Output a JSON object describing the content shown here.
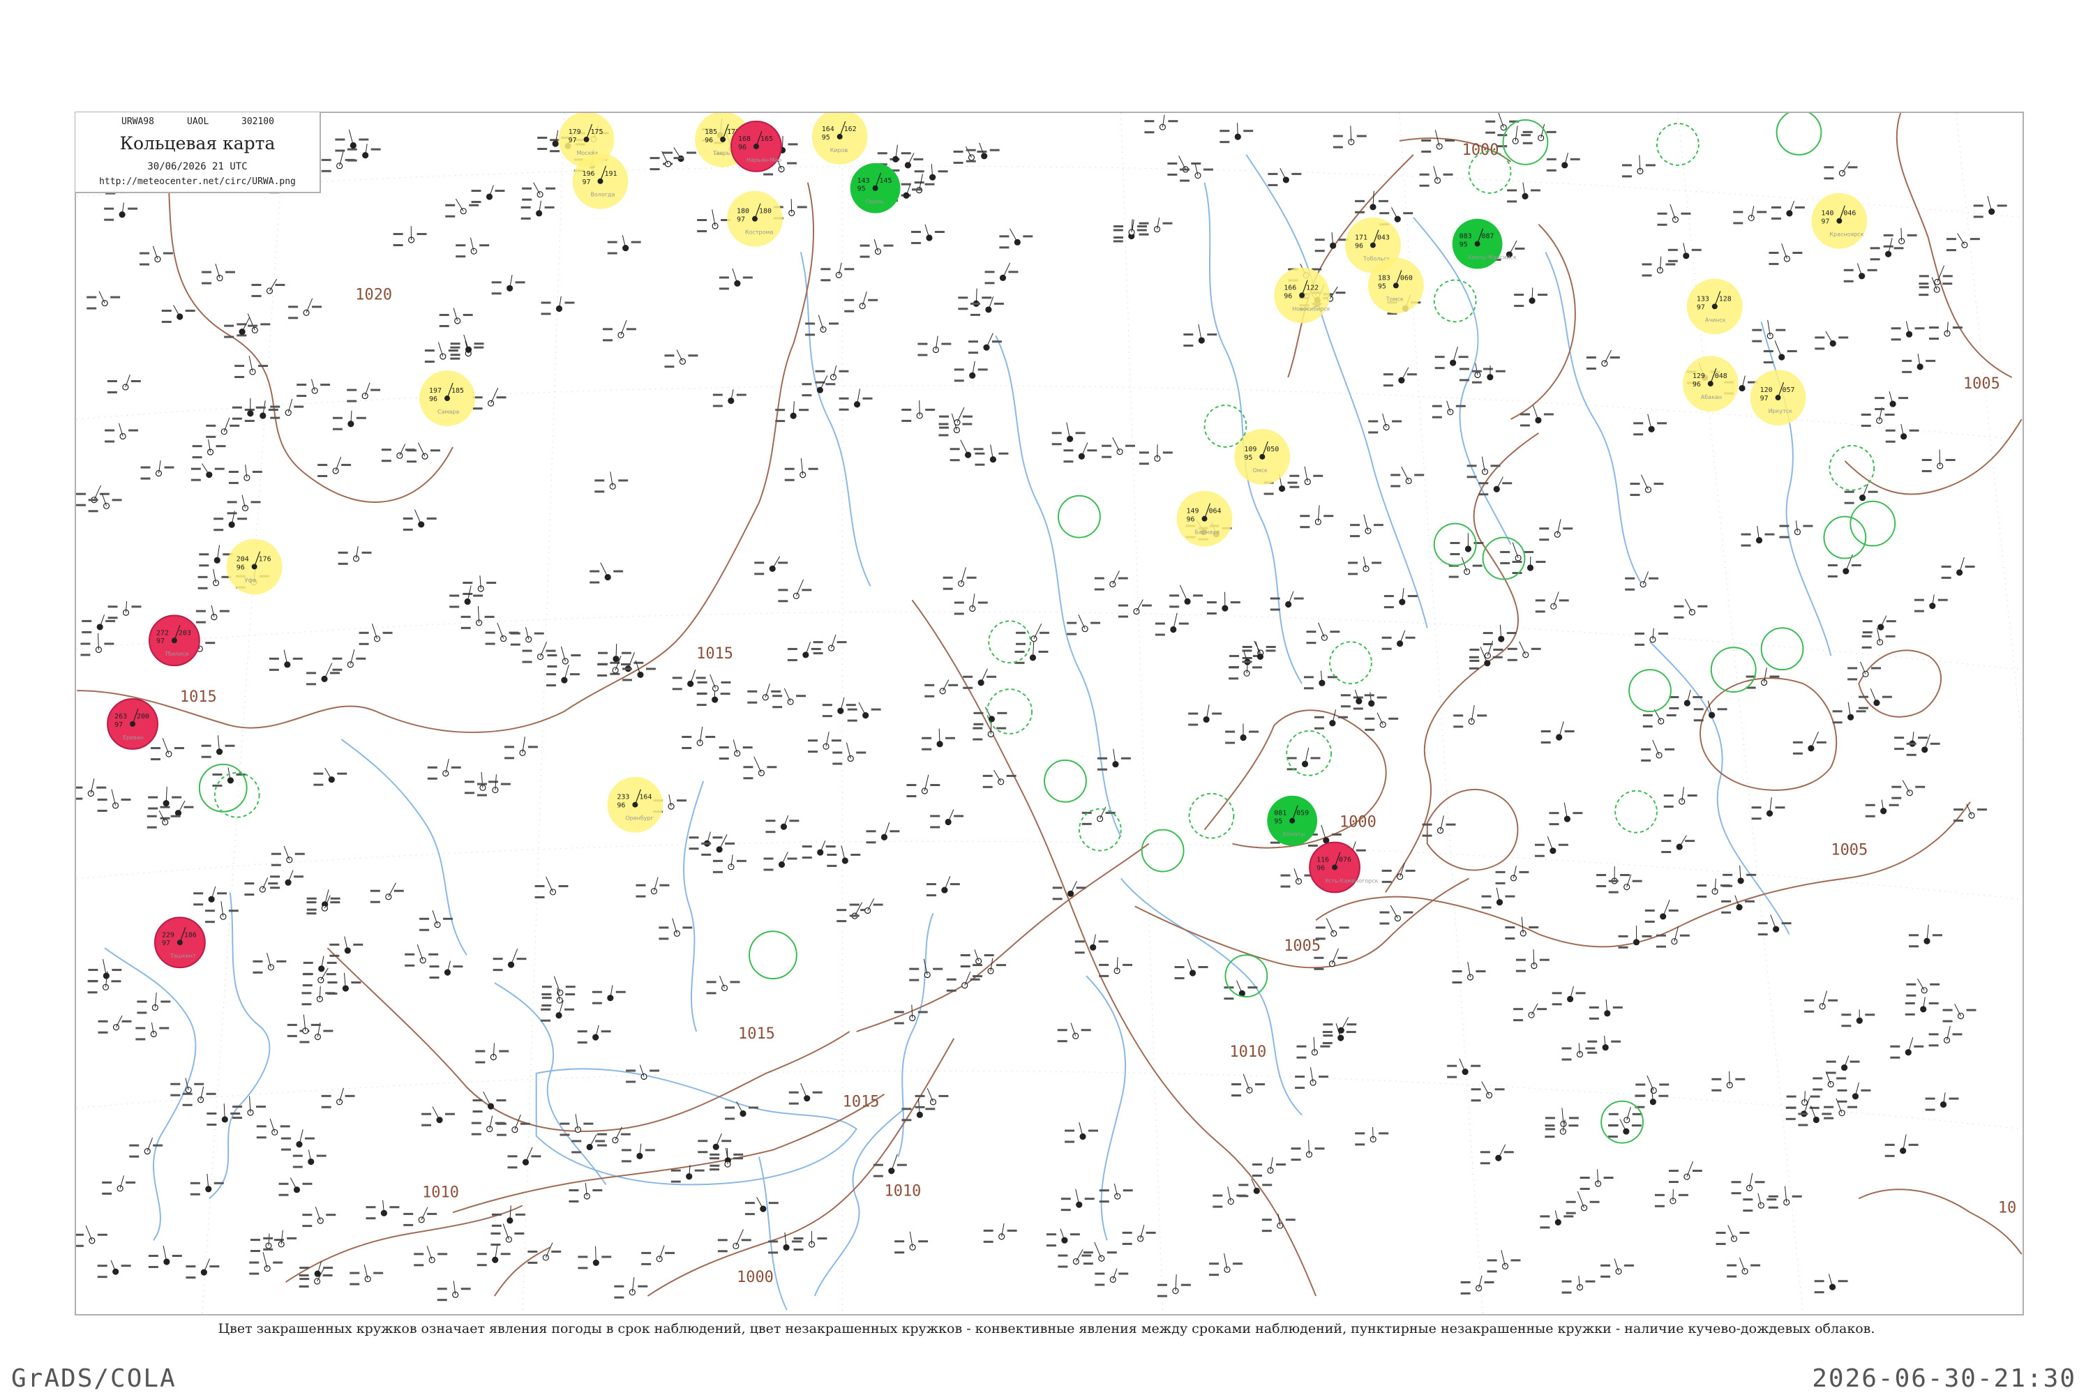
{
  "header": {
    "code1": "URWA98",
    "code2": "UAOL",
    "code3": "302100",
    "title": "Кольцевая карта",
    "datetime": "30/06/2026 21 UTC",
    "url": "http://meteocenter.net/circ/URWA.png"
  },
  "caption": "Цвет закрашенных кружков означает явления погоды в срок наблюдений, цвет незакрашенных кружков - конвективные явления между сроками наблюдений, пунктирные незакрашенные кружки - наличие кучево-дождевых облаков.",
  "footer": {
    "software": "GrADS/COLA",
    "timestamp": "2026-06-30-21:30"
  },
  "colors": {
    "isobar": "#a06a55",
    "river": "#8ab8e6",
    "fog": "#fff27a",
    "rain": "#19c43a",
    "thunder": "#e8305a",
    "convective_ring": "#3dbb55",
    "station": "#222222"
  },
  "isobar_labels": [
    "1020",
    "1015",
    "1015",
    "1015",
    "1015",
    "1010",
    "1010",
    "1010",
    "1005",
    "1005",
    "1005",
    "1000",
    "1000",
    "1000",
    "10"
  ],
  "stations": [
    {
      "name": "Москва",
      "values": [
        "179",
        "97",
        "175"
      ],
      "phenomenon": "fog"
    },
    {
      "name": "Тверь",
      "values": [
        "185",
        "96",
        "172"
      ],
      "phenomenon": "fog"
    },
    {
      "name": "Вологда",
      "values": [
        "196",
        "97",
        "191"
      ],
      "phenomenon": "fog"
    },
    {
      "name": "Кострома",
      "values": [
        "180",
        "97",
        "180"
      ],
      "phenomenon": "fog"
    },
    {
      "name": "Киров",
      "values": [
        "164",
        "95",
        "162"
      ],
      "phenomenon": "fog"
    },
    {
      "name": "Пермь",
      "values": [
        "143",
        "95",
        "145"
      ],
      "phenomenon": "rain"
    },
    {
      "name": "Ханты-Мансийск",
      "values": [
        "083",
        "95",
        "087"
      ],
      "phenomenon": "rain"
    },
    {
      "name": "Тобольск",
      "values": [
        "171",
        "96",
        "043"
      ],
      "phenomenon": "fog"
    },
    {
      "name": "Омск",
      "values": [
        "109",
        "95",
        "050"
      ],
      "phenomenon": "fog"
    },
    {
      "name": "Новосибирск",
      "values": [
        "166",
        "96",
        "122"
      ],
      "phenomenon": "fog"
    },
    {
      "name": "Томск",
      "values": [
        "183",
        "95",
        "060"
      ],
      "phenomenon": "fog"
    },
    {
      "name": "Барнаул",
      "values": [
        "149",
        "96",
        "064"
      ],
      "phenomenon": "fog"
    },
    {
      "name": "Красноярск",
      "values": [
        "140",
        "97",
        "046"
      ],
      "phenomenon": "fog"
    },
    {
      "name": "Абакан",
      "values": [
        "129",
        "96",
        "048"
      ],
      "phenomenon": "fog"
    },
    {
      "name": "Иркутск",
      "values": [
        "120",
        "97",
        "057"
      ],
      "phenomenon": "fog"
    },
    {
      "name": "Ачинск",
      "values": [
        "133",
        "97",
        "128"
      ],
      "phenomenon": "fog"
    },
    {
      "name": "Оренбург",
      "values": [
        "233",
        "96",
        "164"
      ],
      "phenomenon": "fog"
    },
    {
      "name": "Уфа",
      "values": [
        "204",
        "96",
        "176"
      ],
      "phenomenon": "fog"
    },
    {
      "name": "Самара",
      "values": [
        "197",
        "96",
        "185"
      ],
      "phenomenon": "fog"
    },
    {
      "name": "Тбилиси",
      "values": [
        "272",
        "97",
        "203"
      ],
      "phenomenon": "thunder"
    },
    {
      "name": "Ереван",
      "values": [
        "263",
        "97",
        "200"
      ],
      "phenomenon": "thunder"
    },
    {
      "name": "Ташкент",
      "values": [
        "229",
        "97",
        "186"
      ],
      "phenomenon": "thunder"
    },
    {
      "name": "Алматы",
      "values": [
        "081",
        "95",
        "059"
      ],
      "phenomenon": "rain"
    },
    {
      "name": "Усть-Каменогорск",
      "values": [
        "116",
        "96",
        "076"
      ],
      "phenomenon": "thunder"
    },
    {
      "name": "Нарьян-Мар",
      "values": [
        "168",
        "96",
        "165"
      ],
      "phenomenon": "thunder"
    }
  ]
}
